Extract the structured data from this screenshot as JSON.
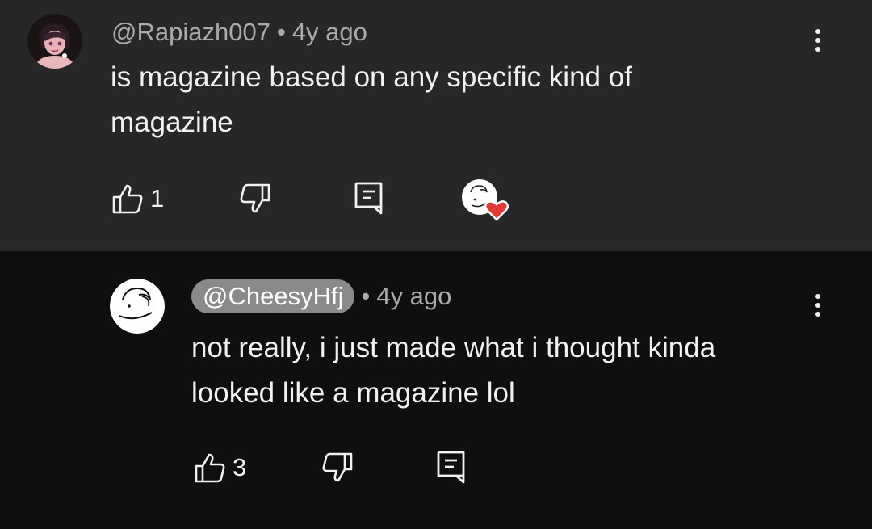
{
  "comment": {
    "author": "@Rapiazh007",
    "separator": "•",
    "time": "4y ago",
    "text_line1": "is magazine based on any specific kind of",
    "text_line2": "magazine",
    "likes": "1",
    "icons": {
      "like": "thumbs-up-icon",
      "dislike": "thumbs-down-icon",
      "reply": "reply-icon",
      "heart": "creator-heart-icon",
      "more": "more-vert-icon"
    }
  },
  "reply": {
    "author": "@CheesyHfj",
    "separator": "•",
    "time": "4y ago",
    "text_line1": "not really, i just made what i thought kinda",
    "text_line2": "looked like a magazine lol",
    "likes": "3"
  },
  "colors": {
    "top_bg": "#272727",
    "reply_bg": "#0f0f0f",
    "meta_text": "#aaaaaa",
    "heart": "#e53935",
    "author_pill": "#8a8a8a"
  }
}
